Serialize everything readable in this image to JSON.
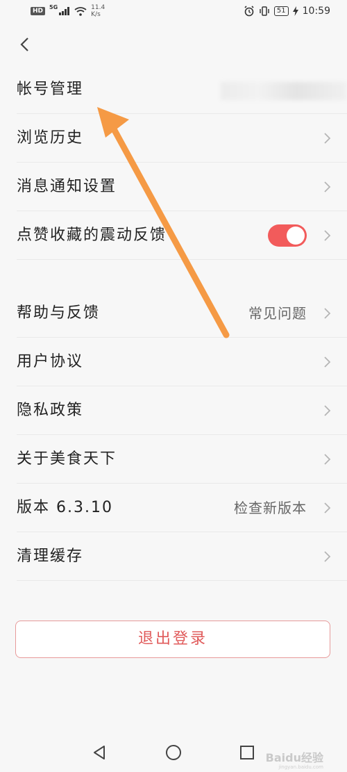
{
  "status_bar": {
    "hd": "HD",
    "network": "5G",
    "net_speed_value": "11.4",
    "net_speed_unit": "K/s",
    "battery": "51",
    "time": "10:59"
  },
  "menu": {
    "account": "帐号管理",
    "history": "浏览历史",
    "notifications": "消息通知设置",
    "vibration_feedback": "点赞收藏的震动反馈",
    "help": "帮助与反馈",
    "help_value": "常见问题",
    "user_agreement": "用户协议",
    "privacy": "隐私政策",
    "about": "关于美食天下",
    "version": "版本 6.3.10",
    "version_value": "检查新版本",
    "clear_cache": "清理缓存"
  },
  "vibration_toggle_on": true,
  "logout_label": "退出登录",
  "watermark": "Baidu经验",
  "watermark_url": "jingyan.baidu.com",
  "colors": {
    "accent": "#f25b5b",
    "annotation_arrow": "#f59a45"
  }
}
